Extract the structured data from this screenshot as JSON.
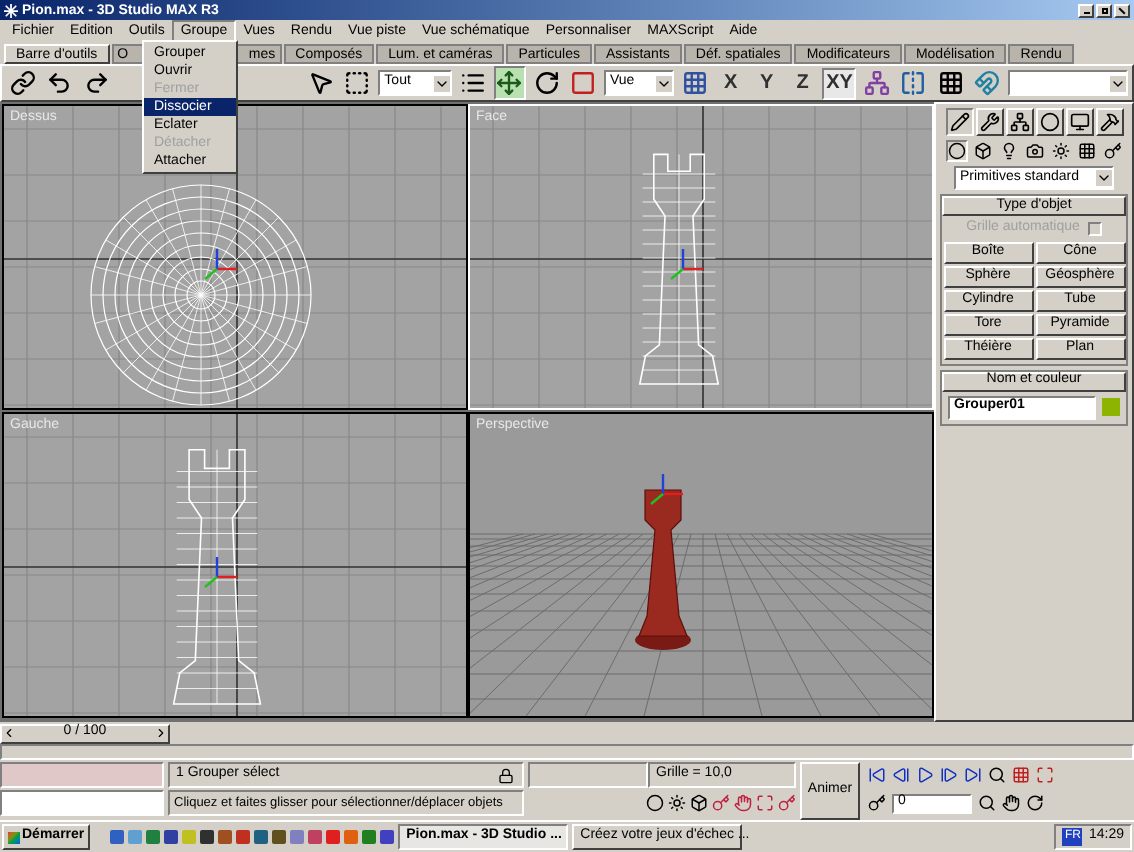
{
  "window": {
    "title": "Pion.max - 3D Studio MAX R3"
  },
  "menu": [
    {
      "label": "Fichier",
      "open": false
    },
    {
      "label": "Edition",
      "open": false
    },
    {
      "label": "Outils",
      "open": false
    },
    {
      "label": "Groupe",
      "open": true
    },
    {
      "label": "Vues",
      "open": false
    },
    {
      "label": "Rendu",
      "open": false
    },
    {
      "label": "Vue piste",
      "open": false
    },
    {
      "label": "Vue schématique",
      "open": false
    },
    {
      "label": "Personnaliser",
      "open": false
    },
    {
      "label": "MAXScript",
      "open": false
    },
    {
      "label": "Aide",
      "open": false
    }
  ],
  "group_menu": [
    {
      "label": "Grouper",
      "disabled": false,
      "selected": false
    },
    {
      "label": "Ouvrir",
      "disabled": false,
      "selected": false
    },
    {
      "label": "Fermer",
      "disabled": true,
      "selected": false
    },
    {
      "label": "Dissocier",
      "disabled": false,
      "selected": true
    },
    {
      "label": "Eclater",
      "disabled": false,
      "selected": false
    },
    {
      "label": "Détacher",
      "disabled": true,
      "selected": false
    },
    {
      "label": "Attacher",
      "disabled": false,
      "selected": false
    }
  ],
  "tabs": [
    {
      "label": "Barre d'outils",
      "selected": true
    },
    {
      "label": "O",
      "selected": false
    },
    {
      "label": "mes",
      "selected": false
    },
    {
      "label": "Composés",
      "selected": false
    },
    {
      "label": "Lum. et caméras",
      "selected": false
    },
    {
      "label": "Particules",
      "selected": false
    },
    {
      "label": "Assistants",
      "selected": false
    },
    {
      "label": "Déf. spatiales",
      "selected": false
    },
    {
      "label": "Modificateurs",
      "selected": false
    },
    {
      "label": "Modélisation",
      "selected": false
    },
    {
      "label": "Rendu",
      "selected": false
    }
  ],
  "toolbar": {
    "selection_filter": "Tout",
    "coordinate_system": "Vue",
    "constraints": [
      {
        "label": "X",
        "selected": false
      },
      {
        "label": "Y",
        "selected": false
      },
      {
        "label": "Z",
        "selected": false
      },
      {
        "label": "XY",
        "selected": true
      }
    ]
  },
  "viewports": [
    {
      "label": "Dessus",
      "kind": "top",
      "active": false
    },
    {
      "label": "Face",
      "kind": "front",
      "active": true
    },
    {
      "label": "Gauche",
      "kind": "left",
      "active": false
    },
    {
      "label": "Perspective",
      "kind": "perspective",
      "active": false
    }
  ],
  "command_panel": {
    "category": "Primitives standard",
    "object_type": {
      "title": "Type d'objet",
      "autogrid": {
        "label": "Grille automatique",
        "checked": false,
        "disabled": true
      },
      "buttons": [
        "Boîte",
        "Cône",
        "Sphère",
        "Géosphère",
        "Cylindre",
        "Tube",
        "Tore",
        "Pyramide",
        "Théière",
        "Plan"
      ]
    },
    "name_color": {
      "title": "Nom et couleur",
      "name": "Grouper01",
      "color": "#8cb400"
    }
  },
  "timeline": {
    "position": "0 / 100"
  },
  "status": {
    "selection": "1 Grouper sélect",
    "prompt": "Cliquez et faites glisser pour sélectionner/déplacer objets",
    "grid": "Grille = 10,0",
    "animate": "Animer",
    "frame": "0"
  },
  "taskbar": {
    "start": "Démarrer",
    "tasks": [
      {
        "label": "Pion.max - 3D Studio ...",
        "selected": true
      },
      {
        "label": "Créez votre jeux d'échec ...",
        "selected": false
      }
    ],
    "language": "FR",
    "clock": "14:29"
  }
}
